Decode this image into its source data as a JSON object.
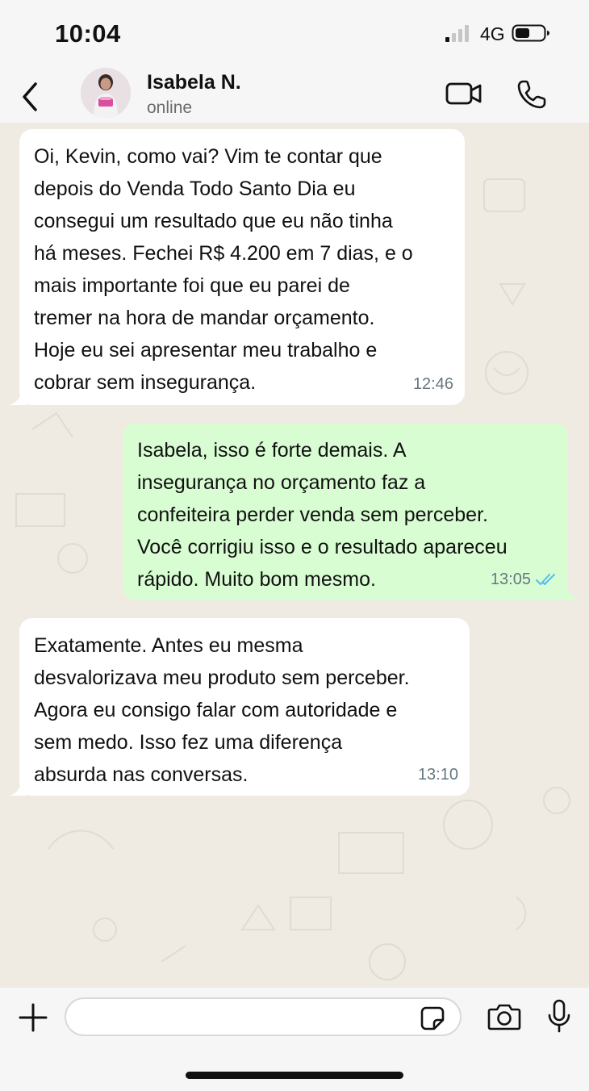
{
  "status_bar": {
    "time": "10:04",
    "network": "4G",
    "signal_icon": "cellular-signal-icon",
    "battery_icon": "battery-icon",
    "battery_level": 0.4
  },
  "header": {
    "contact_name": "Isabela N.",
    "contact_status": "online",
    "back_icon": "chevron-left-icon",
    "video_icon": "video-camera-icon",
    "phone_icon": "phone-icon"
  },
  "messages": [
    {
      "direction": "incoming",
      "text": "Oi, Kevin, como vai? Vim te contar que\ndepois do Venda Todo Santo Dia eu\nconsegui um resultado que eu não tinha\nhá meses. Fechei R$ 4.200 em 7 dias, e o\nmais importante foi que eu parei de\ntremer na hora de mandar orçamento.\nHoje eu sei apresentar meu trabalho e\ncobrar sem insegurança.",
      "time": "12:46"
    },
    {
      "direction": "outgoing",
      "text": "Isabela, isso é forte demais. A\ninsegurança no orçamento faz a\nconfeiteira perder venda sem perceber.\nVocê corrigiu isso e o resultado apareceu\nrápido. Muito bom mesmo.",
      "time": "13:05",
      "read_icon": "double-check-icon"
    },
    {
      "direction": "incoming",
      "text": "Exatamente. Antes eu mesma\ndesvalorizava meu produto sem perceber.\nAgora eu consigo falar com autoridade e\nsem medo. Isso fez uma diferença\nabsurda nas conversas.",
      "time": "13:10"
    }
  ],
  "input_bar": {
    "placeholder": "",
    "value": "",
    "plus_icon": "plus-icon",
    "sticker_icon": "sticker-icon",
    "camera_icon": "camera-icon",
    "mic_icon": "microphone-icon"
  },
  "colors": {
    "incoming_bubble": "#ffffff",
    "outgoing_bubble": "#d9fdd3",
    "chat_background": "#efeae2",
    "read_receipt": "#53bdeb",
    "timestamp": "#667781"
  }
}
